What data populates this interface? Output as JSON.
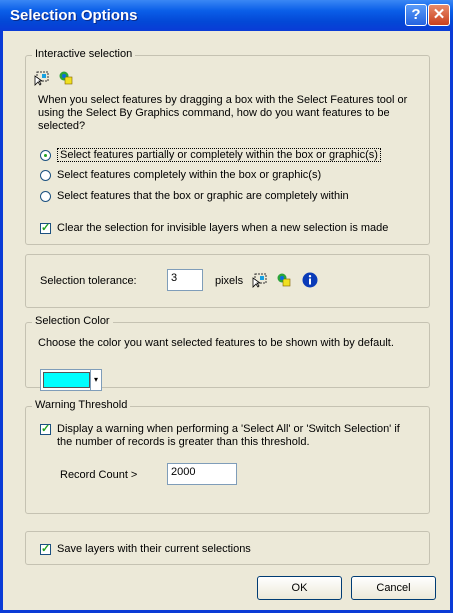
{
  "window": {
    "title": "Selection Options",
    "help_glyph": "?",
    "close_glyph": "✕"
  },
  "interactive": {
    "legend": "Interactive selection",
    "description": "When you select features by dragging a box with the Select Features tool or using the Select By Graphics command, how do you want features to be selected?",
    "options": [
      {
        "label": "Select features partially or completely within the box or graphic(s)",
        "selected": true
      },
      {
        "label": "Select features completely within the box or graphic(s)",
        "selected": false
      },
      {
        "label": "Select features that the box or graphic are completely within",
        "selected": false
      }
    ],
    "clear_label": "Clear the selection for invisible layers when a new selection is made",
    "clear_checked": true
  },
  "tolerance": {
    "label": "Selection tolerance:",
    "value": "3",
    "unit": "pixels"
  },
  "color": {
    "legend": "Selection Color",
    "description": "Choose the color you want selected features to be shown with by default.",
    "swatch": "#00ffff"
  },
  "warning": {
    "legend": "Warning Threshold",
    "display_label": "Display a warning when performing a 'Select All' or 'Switch Selection' if the number of records is greater than this threshold.",
    "display_checked": true,
    "record_label": "Record Count >",
    "record_value": "2000"
  },
  "save_layers": {
    "label": "Save layers with their current selections",
    "checked": true
  },
  "buttons": {
    "ok": "OK",
    "cancel": "Cancel"
  }
}
